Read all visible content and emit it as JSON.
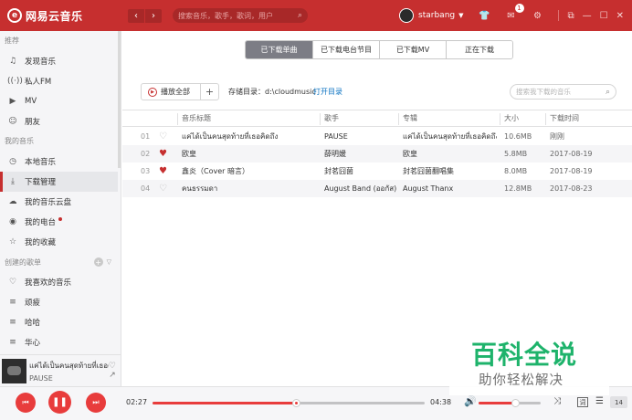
{
  "titlebar": {
    "app_name": "网易云音乐",
    "search_placeholder": "搜索音乐，歌手，歌词，用户",
    "username": "starbang",
    "message_count": "1",
    "accent": "#c62f2f"
  },
  "sidebar": {
    "section_recommend": "推荐",
    "recommend_items": [
      {
        "label": "发现音乐",
        "icon": "music-note-icon"
      },
      {
        "label": "私人FM",
        "icon": "radio-icon"
      },
      {
        "label": "MV",
        "icon": "video-icon"
      },
      {
        "label": "朋友",
        "icon": "friends-icon"
      }
    ],
    "section_my_music": "我的音乐",
    "my_music_items": [
      {
        "label": "本地音乐",
        "icon": "local-music-icon"
      },
      {
        "label": "下载管理",
        "icon": "download-icon"
      },
      {
        "label": "我的音乐云盘",
        "icon": "cloud-icon"
      },
      {
        "label": "我的电台",
        "icon": "podcast-icon"
      },
      {
        "label": "我的收藏",
        "icon": "collect-icon"
      }
    ],
    "section_playlists": "创建的歌单",
    "playlist_items": [
      {
        "label": "我喜欢的音乐",
        "icon": "heart-icon"
      },
      {
        "label": "顽疲",
        "icon": "playlist-icon"
      },
      {
        "label": "哈哈",
        "icon": "playlist-icon"
      },
      {
        "label": "华心",
        "icon": "playlist-icon"
      }
    ]
  },
  "mini_player": {
    "title": "แค่ได้เป็นคนสุดท้ายที่เธอคิดถึง",
    "artist": "PAUSE"
  },
  "tabs": [
    "已下载单曲",
    "已下载电台节目",
    "已下载MV",
    "正在下载"
  ],
  "toolbar": {
    "play_all": "播放全部",
    "add": "+",
    "dir_label": "存储目录：d:\\cloudmusic",
    "open_dir": "打开目录",
    "search_placeholder": "搜索我下载的音乐"
  },
  "table": {
    "headers": {
      "title": "音乐标题",
      "artist": "歌手",
      "album": "专辑",
      "size": "大小",
      "time": "下载时间"
    },
    "rows": [
      {
        "num": "01",
        "liked": false,
        "title": "แค่ได้เป็นคนสุดท้ายที่เธอคิดถึง",
        "artist": "PAUSE",
        "album": "แค่ได้เป็นคนสุดท้ายที่เธอคิดถึง",
        "size": "10.6MB",
        "time": "刚刚"
      },
      {
        "num": "02",
        "liked": true,
        "title": "欧皇",
        "artist": "薛明媛",
        "album": "欧皇",
        "size": "5.8MB",
        "time": "2017-08-19"
      },
      {
        "num": "03",
        "liked": true,
        "title": "鑫炎（Cover 暗言）",
        "artist": "封茗囧菌",
        "album": "封茗囧菌翻唱集",
        "size": "8.0MB",
        "time": "2017-08-19"
      },
      {
        "num": "04",
        "liked": false,
        "title": "คนธรรมดา",
        "artist": "August Band (ออกัส)",
        "album": "August Thanx",
        "size": "12.8MB",
        "time": "2017-08-23"
      }
    ]
  },
  "player": {
    "current_time": "02:27",
    "total_time": "04:38",
    "progress": 0.53,
    "volume": 0.6,
    "lyric_label": "词",
    "playlist_count": "14"
  },
  "watermark": {
    "line1": "百科全说",
    "line2": "助你轻松解决"
  }
}
